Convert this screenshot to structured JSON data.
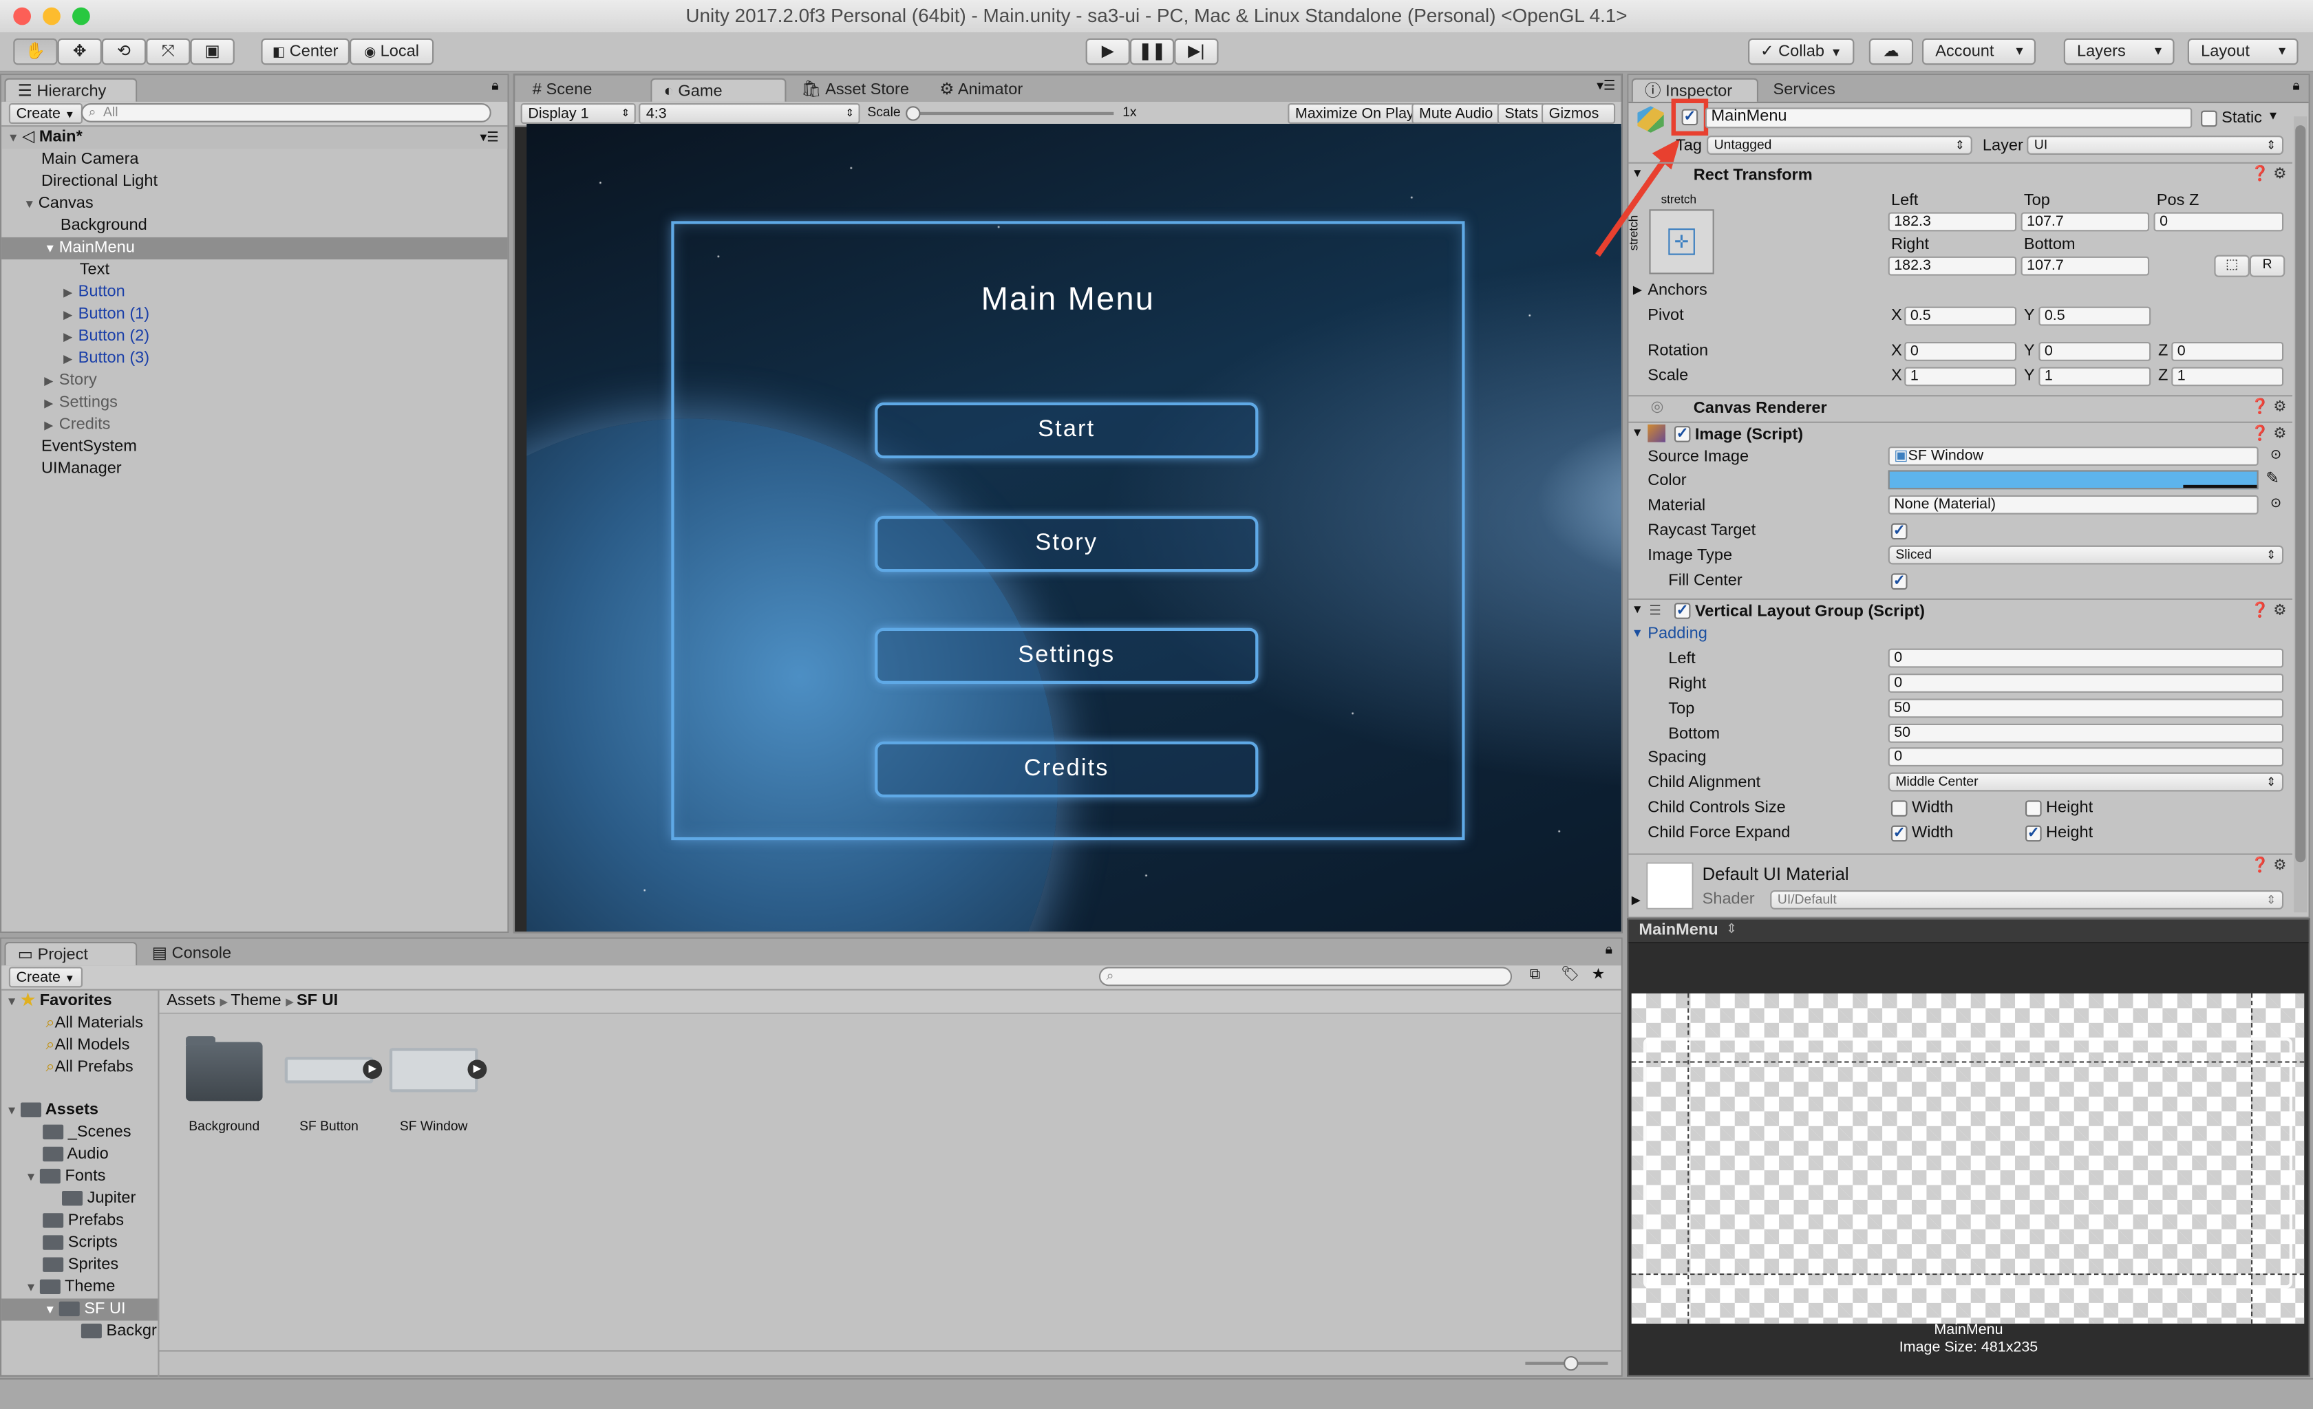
{
  "window": {
    "title": "Unity 2017.2.0f3 Personal (64bit) - Main.unity - sa3-ui - PC, Mac & Linux Standalone (Personal) <OpenGL 4.1>"
  },
  "toolbar": {
    "center_label": "Center",
    "local_label": "Local",
    "collab_label": "Collab",
    "account_label": "Account",
    "layers_label": "Layers",
    "layout_label": "Layout"
  },
  "hierarchy": {
    "tab": "Hierarchy",
    "create": "Create",
    "search_placeholder": "All",
    "scene": "Main*",
    "items": [
      {
        "label": "Main Camera"
      },
      {
        "label": "Directional Light"
      },
      {
        "label": "Canvas"
      },
      {
        "label": "Background"
      },
      {
        "label": "MainMenu"
      },
      {
        "label": "Text"
      },
      {
        "label": "Button"
      },
      {
        "label": "Button (1)"
      },
      {
        "label": "Button (2)"
      },
      {
        "label": "Button (3)"
      },
      {
        "label": "Story"
      },
      {
        "label": "Settings"
      },
      {
        "label": "Credits"
      },
      {
        "label": "EventSystem"
      },
      {
        "label": "UIManager"
      }
    ]
  },
  "center_tabs": {
    "scene": "Scene",
    "game": "Game",
    "asset_store": "Asset Store",
    "animator": "Animator"
  },
  "gamebar": {
    "display": "Display 1",
    "aspect": "4:3",
    "scale_label": "Scale",
    "scale_value": "1x",
    "maximize": "Maximize On Play",
    "mute": "Mute Audio",
    "stats": "Stats",
    "gizmos": "Gizmos"
  },
  "game": {
    "title": "Main Menu",
    "buttons": [
      "Start",
      "Story",
      "Settings",
      "Credits"
    ]
  },
  "inspector": {
    "tab": "Inspector",
    "services_tab": "Services",
    "object_name": "MainMenu",
    "static_label": "Static",
    "tag_label": "Tag",
    "tag_value": "Untagged",
    "layer_label": "Layer",
    "layer_value": "UI",
    "rect": {
      "title": "Rect Transform",
      "stretch_top": "stretch",
      "stretch_side": "stretch",
      "left_label": "Left",
      "top_label": "Top",
      "posz_label": "Pos Z",
      "left": "182.3",
      "top": "107.7",
      "posz": "0",
      "right_label": "Right",
      "bottom_label": "Bottom",
      "right": "182.3",
      "bottom": "107.7",
      "r_button": "R",
      "anchors": "Anchors",
      "pivot": "Pivot",
      "pivot_x": "0.5",
      "pivot_y": "0.5",
      "rotation": "Rotation",
      "rot_x": "0",
      "rot_y": "0",
      "rot_z": "0",
      "scale": "Scale",
      "scale_x": "1",
      "scale_y": "1",
      "scale_z": "1",
      "x": "X",
      "y": "Y",
      "z": "Z"
    },
    "canvas_renderer": "Canvas Renderer",
    "image": {
      "title": "Image (Script)",
      "source_label": "Source Image",
      "source_value": "SF Window",
      "color_label": "Color",
      "color_hex": "#5db4ec",
      "material_label": "Material",
      "material_value": "None (Material)",
      "raycast_label": "Raycast Target",
      "imagetype_label": "Image Type",
      "imagetype_value": "Sliced",
      "fillcenter_label": "Fill Center"
    },
    "vlg": {
      "title": "Vertical Layout Group (Script)",
      "padding": "Padding",
      "left_label": "Left",
      "left": "0",
      "right_label": "Right",
      "right": "0",
      "top_label": "Top",
      "top": "50",
      "bottom_label": "Bottom",
      "bottom": "50",
      "spacing_label": "Spacing",
      "spacing": "0",
      "alignment_label": "Child Alignment",
      "alignment": "Middle Center",
      "controls_label": "Child Controls Size",
      "force_label": "Child Force Expand",
      "width": "Width",
      "height": "Height"
    },
    "material": {
      "title": "Default UI Material",
      "shader_label": "Shader",
      "shader_value": "UI/Default"
    }
  },
  "preview": {
    "title": "MainMenu",
    "caption1": "MainMenu",
    "caption2": "Image Size: 481x235"
  },
  "project": {
    "tab": "Project",
    "console_tab": "Console",
    "create": "Create",
    "favorites": "Favorites",
    "fav_items": [
      "All Materials",
      "All Models",
      "All Prefabs"
    ],
    "assets": "Assets",
    "folders": [
      "_Scenes",
      "Audio",
      "Fonts",
      "Jupiter",
      "Prefabs",
      "Scripts",
      "Sprites",
      "Theme",
      "SF UI",
      "Backgr"
    ],
    "breadcrumb": [
      "Assets",
      "Theme",
      "SF UI"
    ],
    "grid": [
      "Background",
      "SF Button",
      "SF Window"
    ]
  },
  "colors": {
    "annotation": "#e8402f",
    "selection": "#8e8e8e",
    "ui_button_border": "#5fa9e6"
  }
}
